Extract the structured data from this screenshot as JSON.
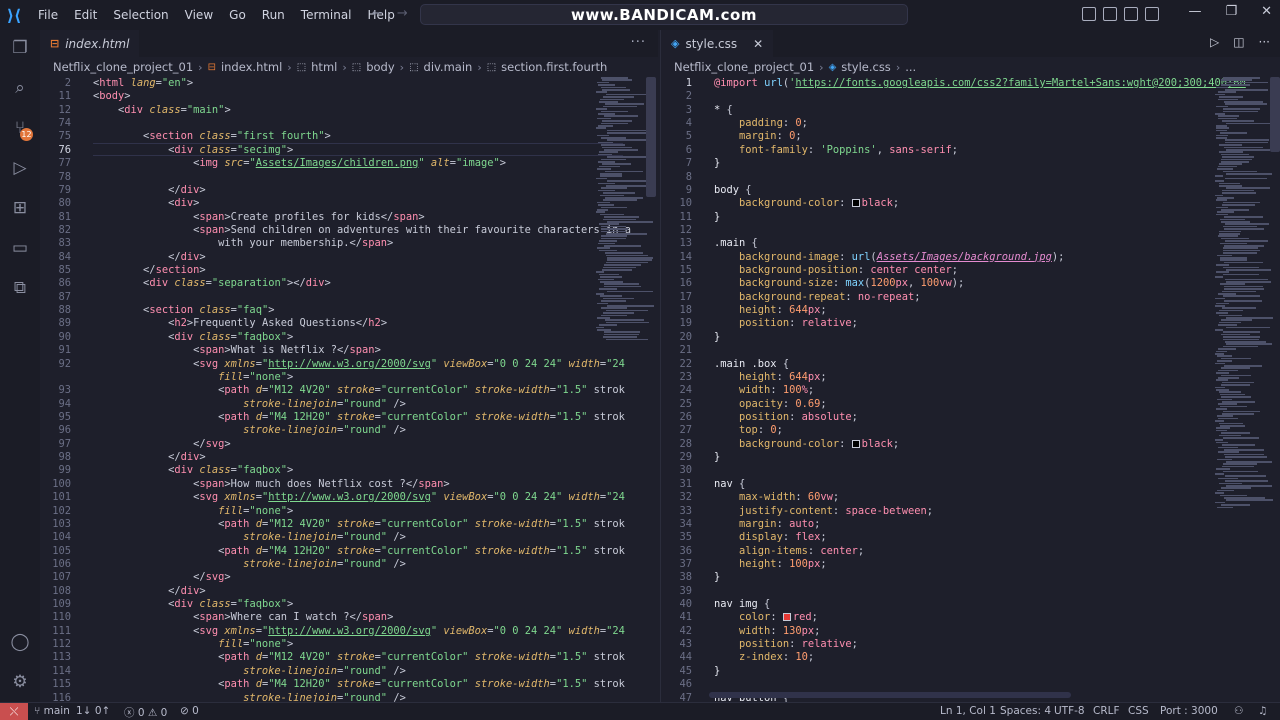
{
  "titlebar": {
    "menu": [
      "File",
      "Edit",
      "Selection",
      "View",
      "Go",
      "Run",
      "Terminal",
      "Help"
    ],
    "watermark": "www.BANDICAM.com"
  },
  "activity": {
    "scm_badge": "12"
  },
  "left_editor": {
    "tab_label": "index.html",
    "breadcrumb": [
      "Netflix_clone_project_01",
      "index.html",
      "html",
      "body",
      "div.main",
      "section.first.fourth"
    ],
    "lines": [
      {
        "n": "2",
        "t": "<html lang=\"en\">"
      },
      {
        "n": "11",
        "t": "<body>"
      },
      {
        "n": "12",
        "t": "    <div class=\"main\">"
      },
      {
        "n": "74",
        "t": ""
      },
      {
        "n": "75",
        "t": "        <section class=\"first fourth\">"
      },
      {
        "n": "76",
        "t": "            <div class=\"secimg\">"
      },
      {
        "n": "77",
        "t": "                <img src=\"Assets/Images/children.png\" alt=\"image\">"
      },
      {
        "n": "78",
        "t": ""
      },
      {
        "n": "79",
        "t": "            </div>"
      },
      {
        "n": "80",
        "t": "            <div>"
      },
      {
        "n": "81",
        "t": "                <span>Create profiles for kids</span>"
      },
      {
        "n": "82",
        "t": "                <span>Send children on adventures with their favourite characters in a"
      },
      {
        "n": "83",
        "t": "                    with your membership.</span>"
      },
      {
        "n": "84",
        "t": "            </div>"
      },
      {
        "n": "85",
        "t": "        </section>"
      },
      {
        "n": "86",
        "t": "        <div class=\"separation\"></div>"
      },
      {
        "n": "87",
        "t": ""
      },
      {
        "n": "88",
        "t": "        <section class=\"faq\">"
      },
      {
        "n": "89",
        "t": "            <h2>Frequently Asked Questions</h2>"
      },
      {
        "n": "90",
        "t": "            <div class=\"faqbox\">"
      },
      {
        "n": "91",
        "t": "                <span>What is Netflix ?</span>"
      },
      {
        "n": "92",
        "t": "                <svg xmlns=\"http://www.w3.org/2000/svg\" viewBox=\"0 0 24 24\" width=\"24"
      },
      {
        "n": "",
        "t": "                    fill=\"none\">"
      },
      {
        "n": "93",
        "t": "                    <path d=\"M12 4V20\" stroke=\"currentColor\" stroke-width=\"1.5\" strok"
      },
      {
        "n": "94",
        "t": "                        stroke-linejoin=\"round\" />"
      },
      {
        "n": "95",
        "t": "                    <path d=\"M4 12H20\" stroke=\"currentColor\" stroke-width=\"1.5\" strok"
      },
      {
        "n": "96",
        "t": "                        stroke-linejoin=\"round\" />"
      },
      {
        "n": "97",
        "t": "                </svg>"
      },
      {
        "n": "98",
        "t": "            </div>"
      },
      {
        "n": "99",
        "t": "            <div class=\"faqbox\">"
      },
      {
        "n": "100",
        "t": "                <span>How much does Netflix cost ?</span>"
      },
      {
        "n": "101",
        "t": "                <svg xmlns=\"http://www.w3.org/2000/svg\" viewBox=\"0 0 24 24\" width=\"24"
      },
      {
        "n": "102",
        "t": "                    fill=\"none\">"
      },
      {
        "n": "103",
        "t": "                    <path d=\"M12 4V20\" stroke=\"currentColor\" stroke-width=\"1.5\" strok"
      },
      {
        "n": "104",
        "t": "                        stroke-linejoin=\"round\" />"
      },
      {
        "n": "105",
        "t": "                    <path d=\"M4 12H20\" stroke=\"currentColor\" stroke-width=\"1.5\" strok"
      },
      {
        "n": "106",
        "t": "                        stroke-linejoin=\"round\" />"
      },
      {
        "n": "107",
        "t": "                </svg>"
      },
      {
        "n": "108",
        "t": "            </div>"
      },
      {
        "n": "109",
        "t": "            <div class=\"faqbox\">"
      },
      {
        "n": "110",
        "t": "                <span>Where can I watch ?</span>"
      },
      {
        "n": "111",
        "t": "                <svg xmlns=\"http://www.w3.org/2000/svg\" viewBox=\"0 0 24 24\" width=\"24"
      },
      {
        "n": "112",
        "t": "                    fill=\"none\">"
      },
      {
        "n": "113",
        "t": "                    <path d=\"M12 4V20\" stroke=\"currentColor\" stroke-width=\"1.5\" strok"
      },
      {
        "n": "114",
        "t": "                        stroke-linejoin=\"round\" />"
      },
      {
        "n": "115",
        "t": "                    <path d=\"M4 12H20\" stroke=\"currentColor\" stroke-width=\"1.5\" strok"
      },
      {
        "n": "116",
        "t": "                        stroke-linejoin=\"round\" />"
      }
    ]
  },
  "right_editor": {
    "tab_label": "style.css",
    "breadcrumb": [
      "Netflix_clone_project_01",
      "style.css",
      "..."
    ],
    "lines": [
      {
        "n": "1",
        "t": "@import url('https://fonts.googleapis.com/css2?family=Martel+Sans:wght@200;300;400;60"
      },
      {
        "n": "2",
        "t": ""
      },
      {
        "n": "3",
        "t": "* {"
      },
      {
        "n": "4",
        "t": "    padding: 0;"
      },
      {
        "n": "5",
        "t": "    margin: 0;"
      },
      {
        "n": "6",
        "t": "    font-family: 'Poppins', sans-serif;"
      },
      {
        "n": "7",
        "t": "}"
      },
      {
        "n": "8",
        "t": ""
      },
      {
        "n": "9",
        "t": "body {"
      },
      {
        "n": "10",
        "t": "    background-color: □black;"
      },
      {
        "n": "11",
        "t": "}"
      },
      {
        "n": "12",
        "t": ""
      },
      {
        "n": "13",
        "t": ".main {"
      },
      {
        "n": "14",
        "t": "    background-image: url(Assets/Images/background.jpg);"
      },
      {
        "n": "15",
        "t": "    background-position: center center;"
      },
      {
        "n": "16",
        "t": "    background-size: max(1200px, 100vw);"
      },
      {
        "n": "17",
        "t": "    background-repeat: no-repeat;"
      },
      {
        "n": "18",
        "t": "    height: 644px;"
      },
      {
        "n": "19",
        "t": "    position: relative;"
      },
      {
        "n": "20",
        "t": "}"
      },
      {
        "n": "21",
        "t": ""
      },
      {
        "n": "22",
        "t": ".main .box {"
      },
      {
        "n": "23",
        "t": "    height: 644px;"
      },
      {
        "n": "24",
        "t": "    width: 100%;"
      },
      {
        "n": "25",
        "t": "    opacity: 0.69;"
      },
      {
        "n": "26",
        "t": "    position: absolute;"
      },
      {
        "n": "27",
        "t": "    top: 0;"
      },
      {
        "n": "28",
        "t": "    background-color: □black;"
      },
      {
        "n": "29",
        "t": "}"
      },
      {
        "n": "30",
        "t": ""
      },
      {
        "n": "31",
        "t": "nav {"
      },
      {
        "n": "32",
        "t": "    max-width: 60vw;"
      },
      {
        "n": "33",
        "t": "    justify-content: space-between;"
      },
      {
        "n": "34",
        "t": "    margin: auto;"
      },
      {
        "n": "35",
        "t": "    display: flex;"
      },
      {
        "n": "36",
        "t": "    align-items: center;"
      },
      {
        "n": "37",
        "t": "    height: 100px;"
      },
      {
        "n": "38",
        "t": "}"
      },
      {
        "n": "39",
        "t": ""
      },
      {
        "n": "40",
        "t": "nav img {"
      },
      {
        "n": "41",
        "t": "    color: ■red;"
      },
      {
        "n": "42",
        "t": "    width: 130px;"
      },
      {
        "n": "43",
        "t": "    position: relative;"
      },
      {
        "n": "44",
        "t": "    z-index: 10;"
      },
      {
        "n": "45",
        "t": "}"
      },
      {
        "n": "46",
        "t": ""
      },
      {
        "n": "47",
        "t": "nav button {"
      }
    ]
  },
  "colors": {
    "red_swatch": "#e53935",
    "black_swatch": "#000000"
  },
  "statusbar": {
    "branch": "main",
    "sync": "1↓ 0↑",
    "problems": "ⓧ 0 ⚠ 0",
    "ports": "⊘ 0",
    "position": "Ln 1, Col 1",
    "spaces": "Spaces: 4",
    "encoding": "UTF-8",
    "eol": "CRLF",
    "language": "CSS",
    "port": "Port : 3000"
  }
}
